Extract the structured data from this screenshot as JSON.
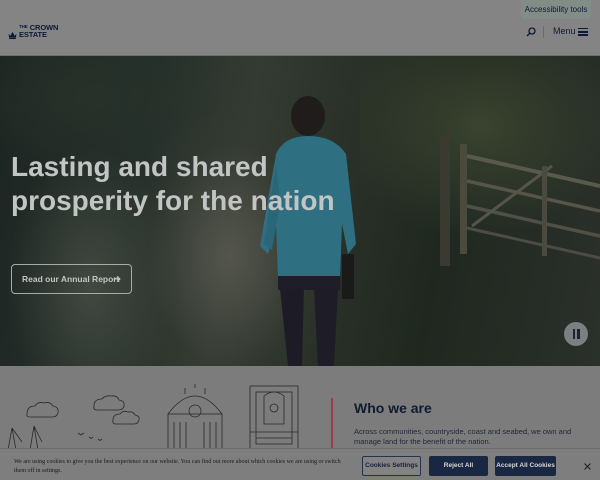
{
  "header": {
    "logo_line1": "THE",
    "logo_line1b": "CROWN",
    "logo_line2": "ESTATE",
    "accessibility_label": "Accessibility tools",
    "menu_label": "Menu"
  },
  "hero": {
    "title_line1": "Lasting and shared",
    "title_line2": "prosperity for the nation",
    "cta_label": "Read our Annual Report"
  },
  "who_we_are": {
    "title": "Who we are",
    "text": "Across communities, countryside, coast and seabed, we own and manage land for the benefit of the nation."
  },
  "cookie_banner": {
    "text": "We are using cookies to give you the best experience on our website. You can find out more about which cookies we are using or switch them off in settings.",
    "settings_label": "Cookies Settings",
    "reject_label": "Reject All",
    "accept_label": "Accept All Cookies"
  },
  "colors": {
    "navy": "#0c1a35",
    "accent": "#9b3a4e",
    "button_dark": "#1a2742"
  }
}
